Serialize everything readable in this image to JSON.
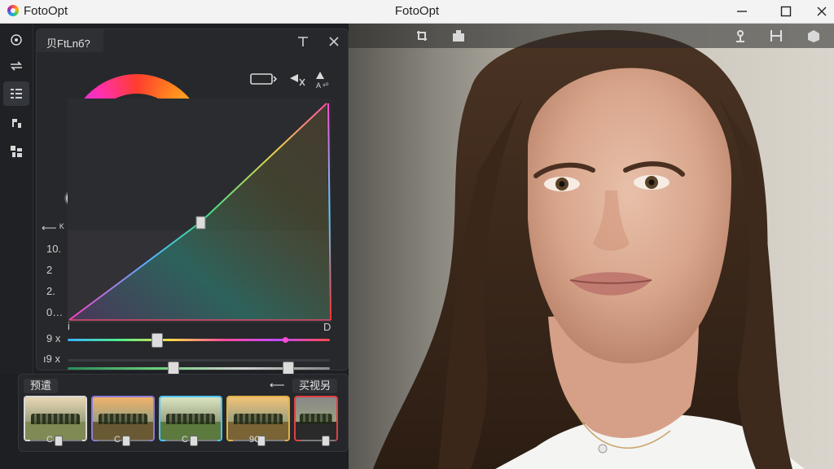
{
  "window": {
    "app_name": "FotoOpt",
    "title": "FotoOpt"
  },
  "panel": {
    "tab_label": "贝FtLnб?"
  },
  "graph": {
    "left_arrow": "⟵ ᴷ",
    "y_ticks": [
      "10.",
      "2",
      "2.",
      "0…"
    ],
    "x_start": "i",
    "x_end": "D"
  },
  "sliders": [
    {
      "label": "9 x",
      "value": 0.34
    },
    {
      "label": "ı9 x",
      "value": 0.4
    }
  ],
  "extra_slider_value": 0.84,
  "presets": {
    "left_tab": "预遣",
    "arrow_label": "⟵",
    "right_tab": "买视另",
    "cards": [
      {
        "label": "C",
        "accent": "#d8d8d8"
      },
      {
        "label": "C",
        "accent": "#8d7bd6"
      },
      {
        "label": "C",
        "accent": "#4fc3f7"
      },
      {
        "label": "9C",
        "accent": "#e0b34a"
      },
      {
        "label": "",
        "accent": "#e04040"
      }
    ]
  },
  "colors": {
    "accent": "#f2c84b",
    "panel_bg": "#27282b",
    "photo_bg": "#cfcac0"
  }
}
